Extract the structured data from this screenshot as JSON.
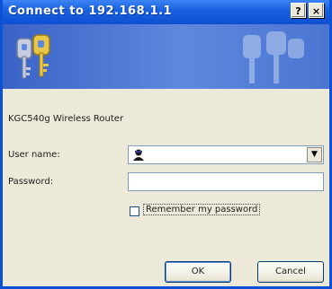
{
  "window": {
    "title": "Connect to 192.168.1.1",
    "help_button": "?",
    "close_button": "×"
  },
  "dialog": {
    "realm": "KGC540g Wireless Router",
    "username_label": "User name:",
    "username_value": "",
    "password_label": "Password:",
    "password_value": "",
    "remember_label": "Remember my password",
    "remember_checked": false,
    "dropdown_arrow": "▼"
  },
  "buttons": {
    "ok_label": "OK",
    "cancel_label": "Cancel"
  },
  "colors": {
    "titlebar": "#0e4fd1",
    "banner": "#4a76d2",
    "dialog_bg": "#ece9d8"
  }
}
